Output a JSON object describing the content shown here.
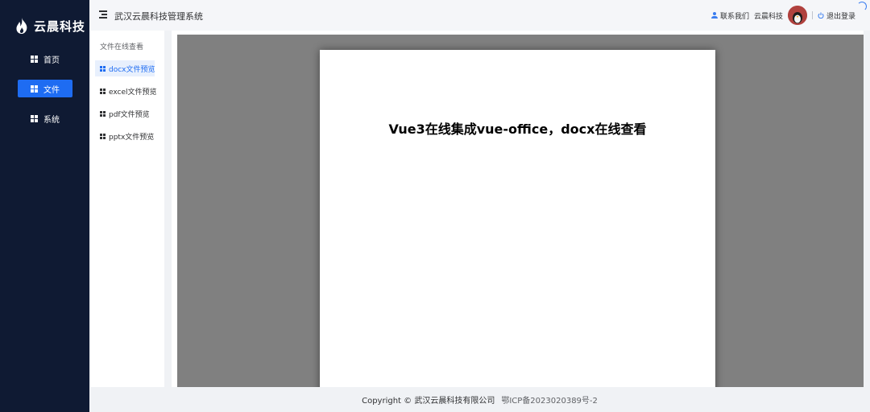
{
  "brand": {
    "name": "云晨科技",
    "icon": "flame-icon"
  },
  "sidebar": {
    "items": [
      {
        "label": "首页",
        "icon": "grid-icon",
        "active": false
      },
      {
        "label": "文件",
        "icon": "grid-icon",
        "active": true
      },
      {
        "label": "系统",
        "icon": "grid-icon",
        "active": false
      }
    ]
  },
  "header": {
    "title": "武汉云晨科技管理系统",
    "contact_label": "联系我们",
    "username": "云晨科技",
    "logout_label": "退出登录"
  },
  "submenu": {
    "heading": "文件在线查看",
    "items": [
      {
        "label": "docx文件预览",
        "active": true
      },
      {
        "label": "excel文件预览",
        "active": false
      },
      {
        "label": "pdf文件预览",
        "active": false
      },
      {
        "label": "pptx文件预览",
        "active": false
      }
    ]
  },
  "document": {
    "title": "Vue3在线集成vue-office，docx在线查看"
  },
  "footer": {
    "copyright": "Copyright © 武汉云晨科技有限公司",
    "icp": "鄂ICP备2023020389号-2"
  },
  "colors": {
    "sidebar_bg": "#0f1a33",
    "accent": "#1e6cf2",
    "viewer_bg": "#808080"
  }
}
